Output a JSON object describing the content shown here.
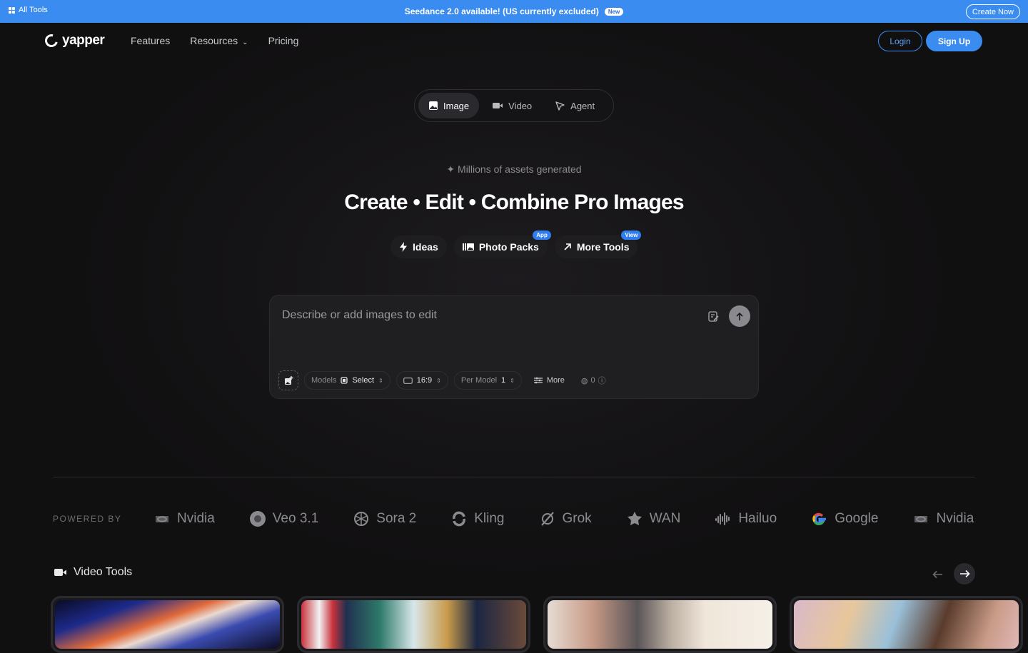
{
  "banner": {
    "all_tools": "All Tools",
    "message": "Seedance 2.0 available! (US currently excluded)",
    "badge": "New",
    "cta": "Create Now"
  },
  "nav": {
    "logo": "yapper",
    "links": [
      "Features",
      "Resources",
      "Pricing"
    ],
    "login": "Login",
    "signup": "Sign Up"
  },
  "modes": [
    {
      "label": "Image",
      "icon": "image-icon",
      "active": true
    },
    {
      "label": "Video",
      "icon": "video-icon",
      "active": false
    },
    {
      "label": "Agent",
      "icon": "agent-icon",
      "active": false
    }
  ],
  "hero": {
    "tagline": "Millions of assets generated",
    "headline": "Create • Edit • Combine Pro Images"
  },
  "chips": [
    {
      "label": "Ideas",
      "icon": "bolt-icon",
      "badge": ""
    },
    {
      "label": "Photo Packs",
      "icon": "photo-packs-icon",
      "badge": "App"
    },
    {
      "label": "More Tools",
      "icon": "arrow-up-right-icon",
      "badge": "View"
    }
  ],
  "prompt": {
    "placeholder": "Describe or add images to edit",
    "models_label": "Models",
    "models_value": "Select",
    "aspect_value": "16:9",
    "per_model_label": "Per Model",
    "per_model_value": "1",
    "more_label": "More",
    "credits": "0"
  },
  "powered_by": {
    "label": "POWERED BY",
    "brands": [
      "Nvidia",
      "Veo 3.1",
      "Sora 2",
      "Kling",
      "Grok",
      "WAN",
      "Hailuo",
      "Google",
      "Nvidia"
    ]
  },
  "video_tools": {
    "title": "Video Tools"
  },
  "colors": {
    "accent": "#3b8cf0",
    "background": "#111011"
  }
}
